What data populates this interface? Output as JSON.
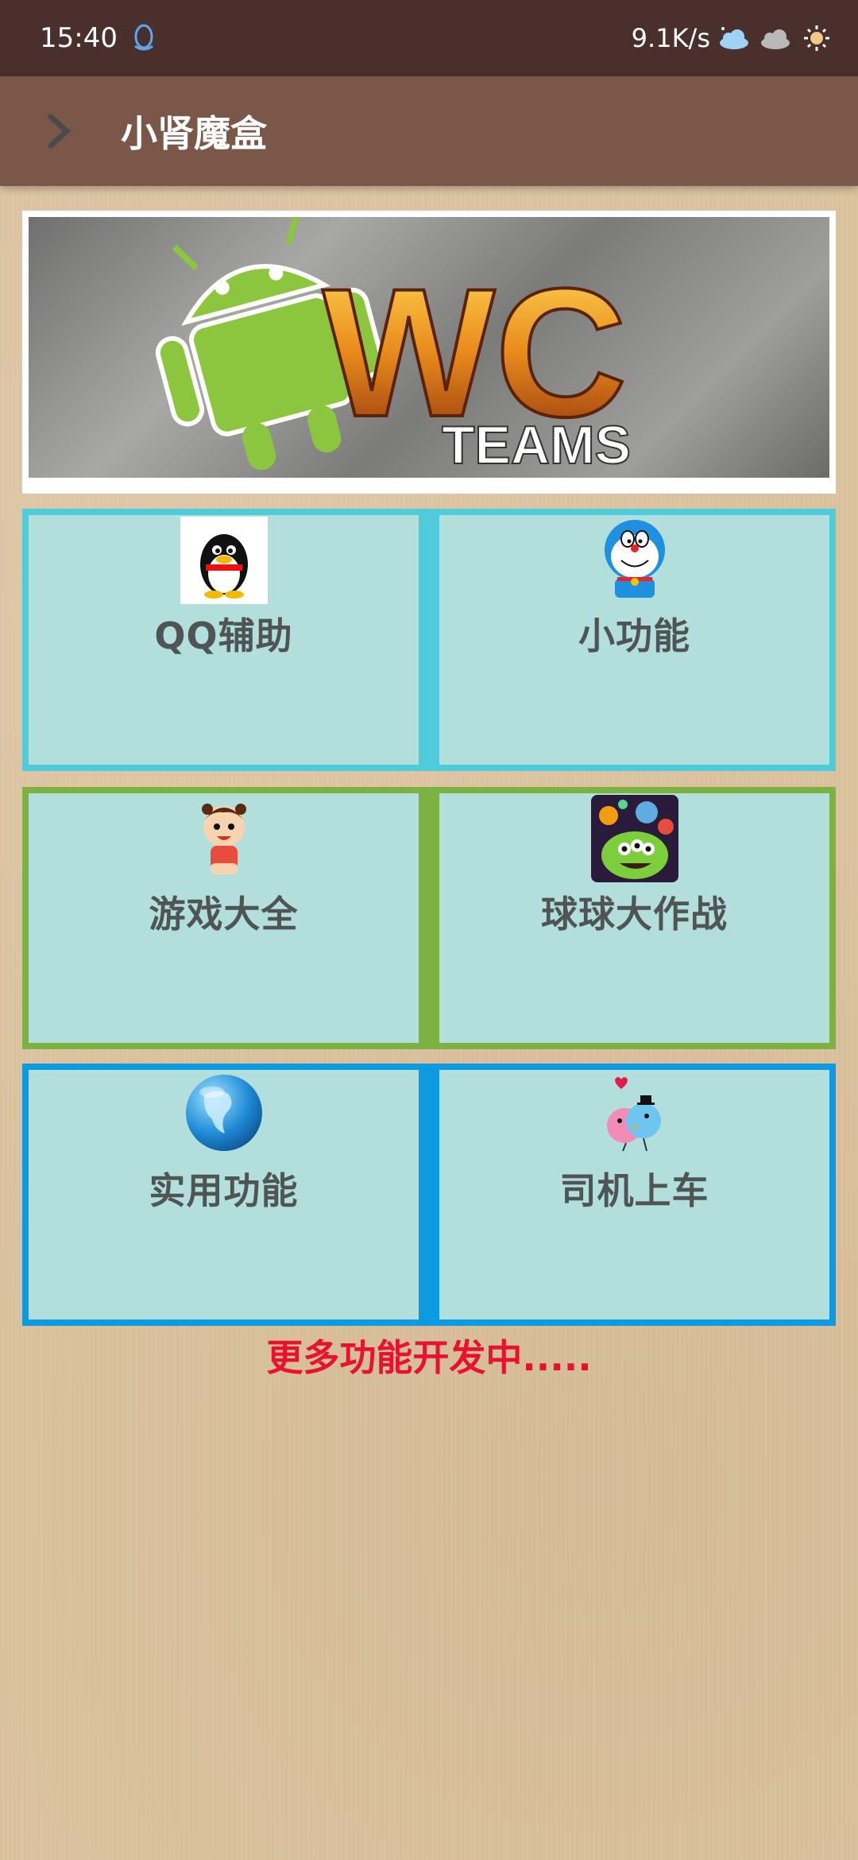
{
  "status_bar": {
    "time": "15:40",
    "net_speed": "9.1K/s",
    "icons": [
      "qq-icon",
      "cloud-weather-icon",
      "cloud-icon",
      "sun-icon"
    ]
  },
  "app_bar": {
    "title": "小肾魔盒",
    "back_icon": "chevron-right-icon"
  },
  "banner": {
    "logo_letters": "WC",
    "logo_subtitle": "TEAMS"
  },
  "tiles": [
    {
      "label": "QQ辅助",
      "icon": "qq-penguin-icon"
    },
    {
      "label": "小功能",
      "icon": "doraemon-icon"
    },
    {
      "label": "游戏大全",
      "icon": "cartoon-kid-icon"
    },
    {
      "label": "球球大作战",
      "icon": "balls-game-icon"
    },
    {
      "label": "实用功能",
      "icon": "globe-icon"
    },
    {
      "label": "司机上车",
      "icon": "birds-couple-icon"
    }
  ],
  "footer": "更多功能开发中.....",
  "colors": {
    "status_bar": "#4a302c",
    "app_bar": "#7a5749",
    "row1_border": "#4fcbdc",
    "row2_border": "#7bb241",
    "row3_border": "#0e9ae0",
    "tile_bg": "#b2dfdc",
    "footer_text": "#e8122e"
  }
}
